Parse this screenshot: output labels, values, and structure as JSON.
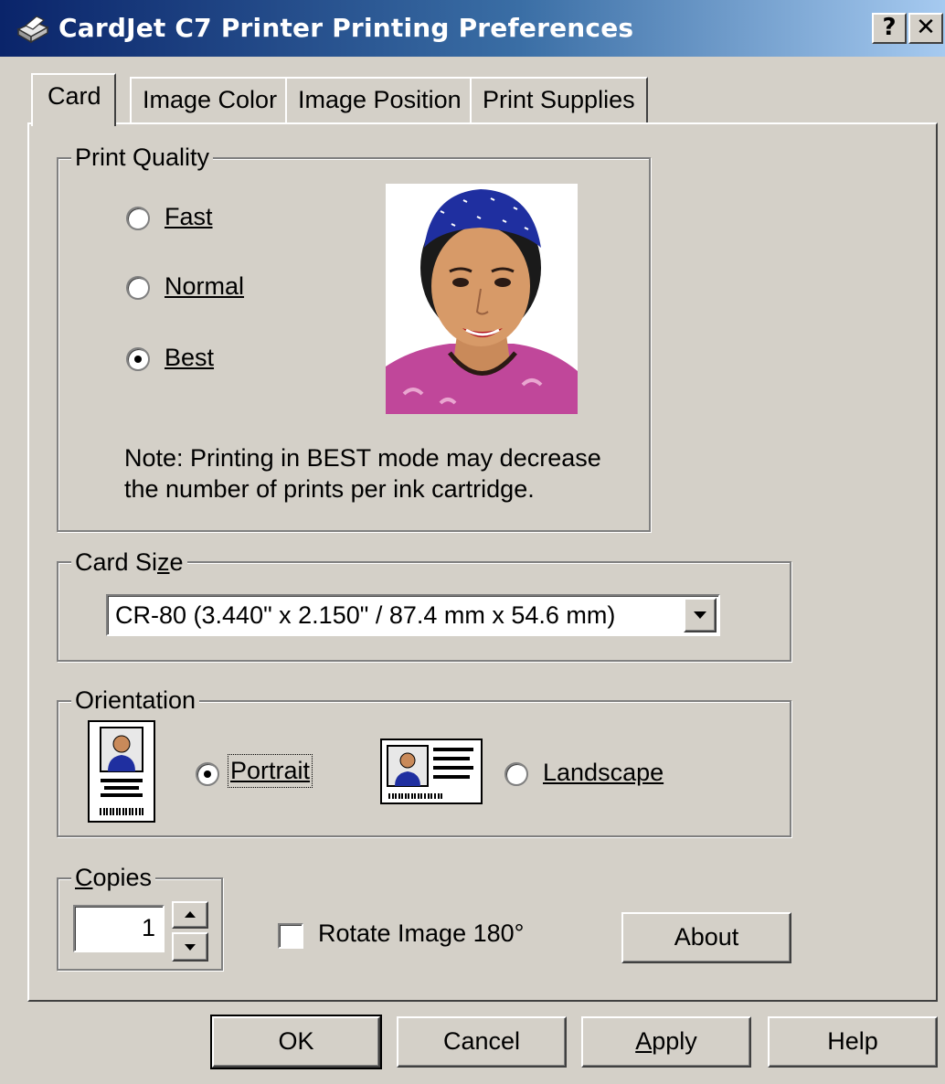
{
  "window": {
    "title": "CardJet C7 Printer Printing Preferences",
    "help_button": "?",
    "close_button": "✕"
  },
  "tabs": [
    {
      "label": "Card",
      "active": true
    },
    {
      "label": "Image Color",
      "active": false
    },
    {
      "label": "Image Position",
      "active": false
    },
    {
      "label": "Print Supplies",
      "active": false
    }
  ],
  "print_quality": {
    "legend": "Print Quality",
    "options": [
      {
        "label": "Fast",
        "checked": false
      },
      {
        "label": "Normal",
        "checked": false
      },
      {
        "label": "Best",
        "checked": true
      }
    ],
    "note_line1": "Note: Printing in BEST mode may decrease",
    "note_line2": "the number of prints per ink cartridge."
  },
  "card_size": {
    "legend": "Card Size",
    "selected": "CR-80 (3.440\" x 2.150\" / 87.4 mm x  54.6 mm)"
  },
  "orientation": {
    "legend": "Orientation",
    "portrait_label": "Portrait",
    "portrait_checked": true,
    "landscape_label": "Landscape",
    "landscape_checked": false
  },
  "copies": {
    "legend": "Copies",
    "value": "1"
  },
  "rotate": {
    "label": "Rotate Image 180°",
    "checked": false
  },
  "about_label": "About",
  "footer": {
    "ok": "OK",
    "cancel": "Cancel",
    "apply": "Apply",
    "help": "Help"
  },
  "colors": {
    "title_start": "#0a246a",
    "title_end": "#a6caf0",
    "face": "#d4d0c8",
    "headband": "#1f2fa0",
    "blouse": "#c0479a"
  }
}
